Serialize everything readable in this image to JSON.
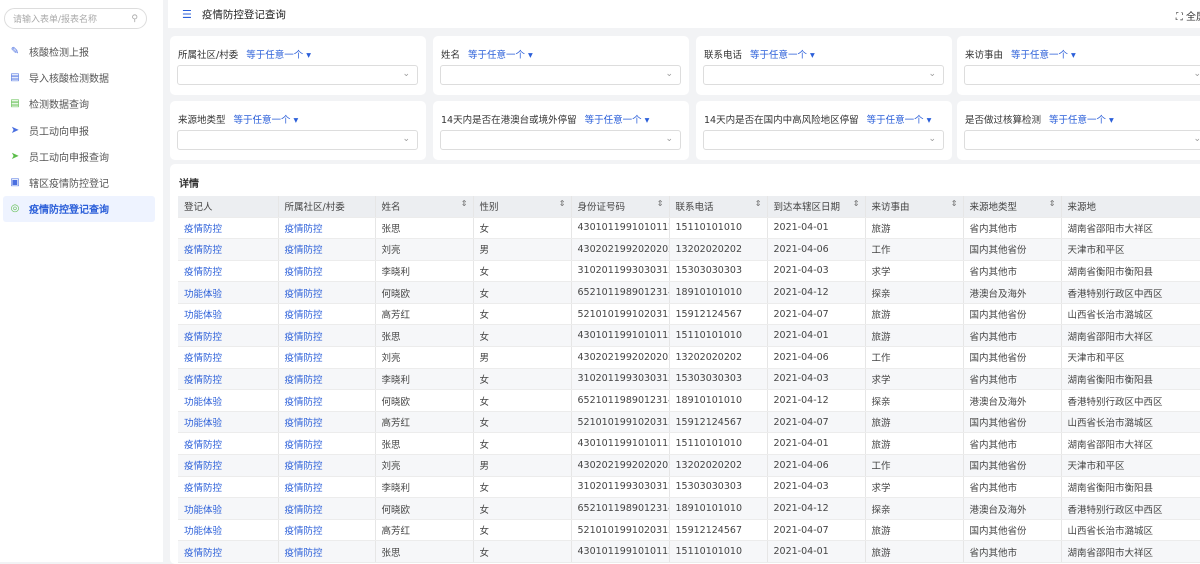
{
  "sidebar": {
    "search_placeholder": "请输入表单/报表名称",
    "items": [
      {
        "label": "核酸检测上报",
        "icon": "edit-icon",
        "color": "#4a6fe0"
      },
      {
        "label": "导入核酸检测数据",
        "icon": "clipboard-icon",
        "color": "#4a6fe0"
      },
      {
        "label": "检测数据查询",
        "icon": "clipboard-icon",
        "color": "#5bbd4a"
      },
      {
        "label": "员工动向申报",
        "icon": "send-icon",
        "color": "#4a6fe0"
      },
      {
        "label": "员工动向申报查询",
        "icon": "send-icon",
        "color": "#5bbd4a"
      },
      {
        "label": "辖区疫情防控登记",
        "icon": "form-icon",
        "color": "#4a6fe0"
      },
      {
        "label": "疫情防控登记查询",
        "icon": "target-icon",
        "color": "#5bbd4a",
        "active": true
      }
    ]
  },
  "header": {
    "title": "疫情防控登记查询",
    "fullscreen_label": "全屏"
  },
  "filters": [
    {
      "label": "所属社区/村委",
      "op": "等于任意一个"
    },
    {
      "label": "姓名",
      "op": "等于任意一个"
    },
    {
      "label": "联系电话",
      "op": "等于任意一个"
    },
    {
      "label": "来访事由",
      "op": "等于任意一个"
    },
    {
      "label": "来源地类型",
      "op": "等于任意一个"
    },
    {
      "label": "14天内是否在港澳台或境外停留",
      "op": "等于任意一个"
    },
    {
      "label": "14天内是否在国内中高风险地区停留",
      "op": "等于任意一个"
    },
    {
      "label": "是否做过核算检测",
      "op": "等于任意一个"
    }
  ],
  "table": {
    "caption": "详情",
    "columns": [
      {
        "label": "登记人",
        "sortable": false
      },
      {
        "label": "所属社区/村委",
        "sortable": false
      },
      {
        "label": "姓名",
        "sortable": true
      },
      {
        "label": "性别",
        "sortable": true
      },
      {
        "label": "身份证号码",
        "sortable": true
      },
      {
        "label": "联系电话",
        "sortable": true
      },
      {
        "label": "到达本辖区日期",
        "sortable": true
      },
      {
        "label": "来访事由",
        "sortable": true
      },
      {
        "label": "来源地类型",
        "sortable": true
      },
      {
        "label": "来源地",
        "sortable": false
      }
    ],
    "rows": [
      [
        "疫情防控",
        "疫情防控",
        "张思",
        "女",
        "430101199101011234",
        "15110101010",
        "2021-04-01",
        "旅游",
        "省内其他市",
        "湖南省邵阳市大祥区"
      ],
      [
        "疫情防控",
        "疫情防控",
        "刘亮",
        "男",
        "430202199202020202",
        "13202020202",
        "2021-04-06",
        "工作",
        "国内其他省份",
        "天津市和平区"
      ],
      [
        "疫情防控",
        "疫情防控",
        "李晓利",
        "女",
        "310201199303031234",
        "15303030303",
        "2021-04-03",
        "求学",
        "省内其他市",
        "湖南省衡阳市衡阳县"
      ],
      [
        "功能体验",
        "疫情防控",
        "何晓欧",
        "女",
        "652101198901231456",
        "18910101010",
        "2021-04-12",
        "探亲",
        "港澳台及海外",
        "香港特别行政区中西区"
      ],
      [
        "功能体验",
        "疫情防控",
        "高芳红",
        "女",
        "521010199102031234",
        "15912124567",
        "2021-04-07",
        "旅游",
        "国内其他省份",
        "山西省长治市潞城区"
      ],
      [
        "疫情防控",
        "疫情防控",
        "张思",
        "女",
        "430101199101011234",
        "15110101010",
        "2021-04-01",
        "旅游",
        "省内其他市",
        "湖南省邵阳市大祥区"
      ],
      [
        "疫情防控",
        "疫情防控",
        "刘亮",
        "男",
        "430202199202020202",
        "13202020202",
        "2021-04-06",
        "工作",
        "国内其他省份",
        "天津市和平区"
      ],
      [
        "疫情防控",
        "疫情防控",
        "李晓利",
        "女",
        "310201199303031234",
        "15303030303",
        "2021-04-03",
        "求学",
        "省内其他市",
        "湖南省衡阳市衡阳县"
      ],
      [
        "功能体验",
        "疫情防控",
        "何晓欧",
        "女",
        "652101198901231456",
        "18910101010",
        "2021-04-12",
        "探亲",
        "港澳台及海外",
        "香港特别行政区中西区"
      ],
      [
        "功能体验",
        "疫情防控",
        "高芳红",
        "女",
        "521010199102031234",
        "15912124567",
        "2021-04-07",
        "旅游",
        "国内其他省份",
        "山西省长治市潞城区"
      ],
      [
        "疫情防控",
        "疫情防控",
        "张思",
        "女",
        "430101199101011234",
        "15110101010",
        "2021-04-01",
        "旅游",
        "省内其他市",
        "湖南省邵阳市大祥区"
      ],
      [
        "疫情防控",
        "疫情防控",
        "刘亮",
        "男",
        "430202199202020202",
        "13202020202",
        "2021-04-06",
        "工作",
        "国内其他省份",
        "天津市和平区"
      ],
      [
        "疫情防控",
        "疫情防控",
        "李晓利",
        "女",
        "310201199303031234",
        "15303030303",
        "2021-04-03",
        "求学",
        "省内其他市",
        "湖南省衡阳市衡阳县"
      ],
      [
        "功能体验",
        "疫情防控",
        "何晓欧",
        "女",
        "652101198901231456",
        "18910101010",
        "2021-04-12",
        "探亲",
        "港澳台及海外",
        "香港特别行政区中西区"
      ],
      [
        "功能体验",
        "疫情防控",
        "高芳红",
        "女",
        "521010199102031234",
        "15912124567",
        "2021-04-07",
        "旅游",
        "国内其他省份",
        "山西省长治市潞城区"
      ],
      [
        "疫情防控",
        "疫情防控",
        "张思",
        "女",
        "430101199101011234",
        "15110101010",
        "2021-04-01",
        "旅游",
        "省内其他市",
        "湖南省邵阳市大祥区"
      ]
    ]
  },
  "colors": {
    "accent": "#2b5fd9",
    "green": "#5bbd4a"
  }
}
